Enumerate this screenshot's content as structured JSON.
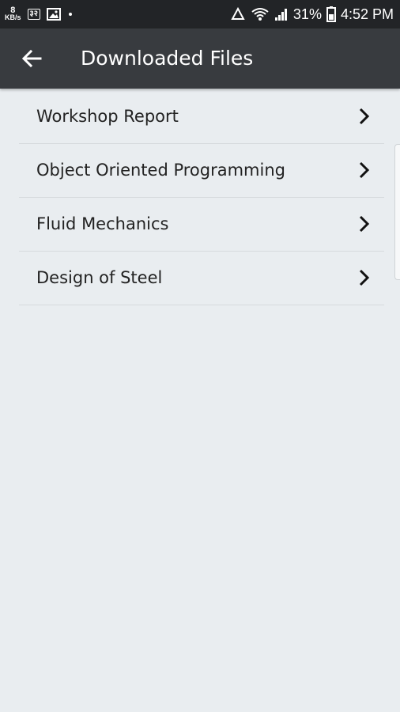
{
  "status_bar": {
    "kbs_value": "8",
    "kbs_unit": "KB/s",
    "badge_text": "३२",
    "battery_percent": "31%",
    "time": "4:52 PM"
  },
  "app_bar": {
    "title": "Downloaded Files"
  },
  "files": [
    {
      "label": "Workshop Report"
    },
    {
      "label": "Object Oriented Programming"
    },
    {
      "label": "Fluid Mechanics"
    },
    {
      "label": "Design of Steel"
    }
  ]
}
